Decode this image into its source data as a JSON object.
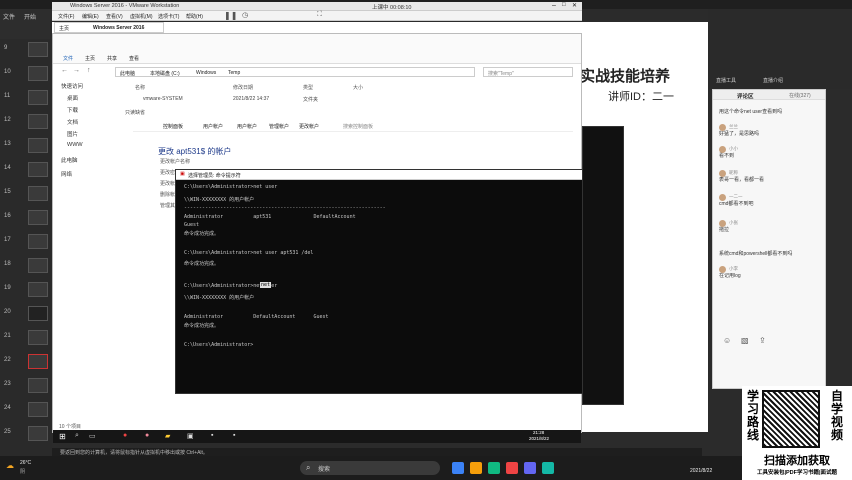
{
  "host": {
    "menu_file": "文件",
    "menu_start": "开始",
    "slide_numbers": [
      "9",
      "10",
      "11",
      "12",
      "13",
      "14",
      "15",
      "16",
      "17",
      "18",
      "19",
      "20",
      "21",
      "22",
      "23",
      "24",
      "25"
    ],
    "slide_title": "实战技能培养",
    "slide_subtitle": "讲师ID：二一",
    "clock": "2021/8/22",
    "weather_temp": "26°C",
    "weather_text": "阴",
    "taskbar_search": "搜索",
    "status_text": "要返回到您的计算机，请将鼠标指针从虚拟机中移出或按 Ctrl+Alt。"
  },
  "vmware": {
    "title": "Windows Server 2016 - VMware Workstation",
    "menu": [
      "文件(F)",
      "编辑(E)",
      "查看(V)",
      "虚拟机(M)",
      "选项卡(T)",
      "帮助(H)"
    ],
    "top_label": "上课中 00:08:10",
    "tab_home": "主页",
    "tab_vm": "Windows Server 2016"
  },
  "explorer": {
    "ribbon_tabs": [
      "文件",
      "主页",
      "共享",
      "查看"
    ],
    "breadcrumb": [
      "此电脑",
      "本地磁盘 (C:)",
      "Windows",
      "Temp"
    ],
    "search_placeholder": "搜索\"Temp\"",
    "columns": [
      "名称",
      "修改日期",
      "类型",
      "大小"
    ],
    "file_row": [
      "vmware-SYSTEM",
      "2021/8/22 14:37",
      "文件夹"
    ],
    "file_row2": "只读缺省",
    "nav_items": [
      "快速访问",
      "桌面",
      "下载",
      "文档",
      "图片",
      "WWW",
      "此电脑",
      "网络"
    ],
    "status": "10 个项目"
  },
  "control_panel": {
    "breadcrumb": [
      "控制面板",
      "用户帐户",
      "用户帐户",
      "管理帐户",
      "更改帐户"
    ],
    "search": "搜索控制面板",
    "heading": "更改 apt531$ 的帐户",
    "lines": [
      "更改帐户名称",
      "更改密码",
      "更改帐户类型",
      "删除帐户",
      "管理其他帐户"
    ]
  },
  "cmd": {
    "title": "选择管理员: 命令提示符",
    "lines": [
      "C:\\Users\\Administrator>net user",
      "\\\\WIN-XXXXXXXX 的用户帐户",
      "-------------------------------------------------------------------",
      "Administrator          apt531              DefaultAccount",
      "Guest",
      "命令成功完成。",
      "",
      "C:\\Users\\Administrator>net user apt531 /del",
      "命令成功完成。",
      "",
      "C:\\Users\\Administrator>net user",
      "\\\\WIN-XXXXXXXX 的用户帐户",
      "",
      "Administrator          DefaultAccount      Guest",
      "命令成功完成。",
      "",
      "C:\\Users\\Administrator>"
    ],
    "highlight": "net"
  },
  "vm_taskbar": {
    "time": "21:28",
    "date": "2021/8/22"
  },
  "stream": {
    "tabs": [
      "直播工具",
      "直播介绍"
    ],
    "panel_title": "评论区",
    "online": "在线(327)",
    "comments": [
      {
        "name": "",
        "text": "用这个命令net user查看到吗"
      },
      {
        "name": "兰兰",
        "text": "好猛了，是思路吗"
      },
      {
        "name": "小小",
        "text": "看不到"
      },
      {
        "name": "昵称",
        "text": "表哥一看，看都一看"
      },
      {
        "name": "一二一",
        "text": "cmd都看不到吧"
      },
      {
        "name": "小张",
        "text": "拖拉"
      },
      {
        "name": "",
        "text": "系统cmd和powershell都看不到吗"
      },
      {
        "name": "小李",
        "text": "在记用log"
      }
    ]
  },
  "promo": {
    "left": "学习路线",
    "right": "自学视频",
    "cta": "扫描添加获取",
    "sub": "工具安装包|PDF学习书籍|面试题"
  }
}
